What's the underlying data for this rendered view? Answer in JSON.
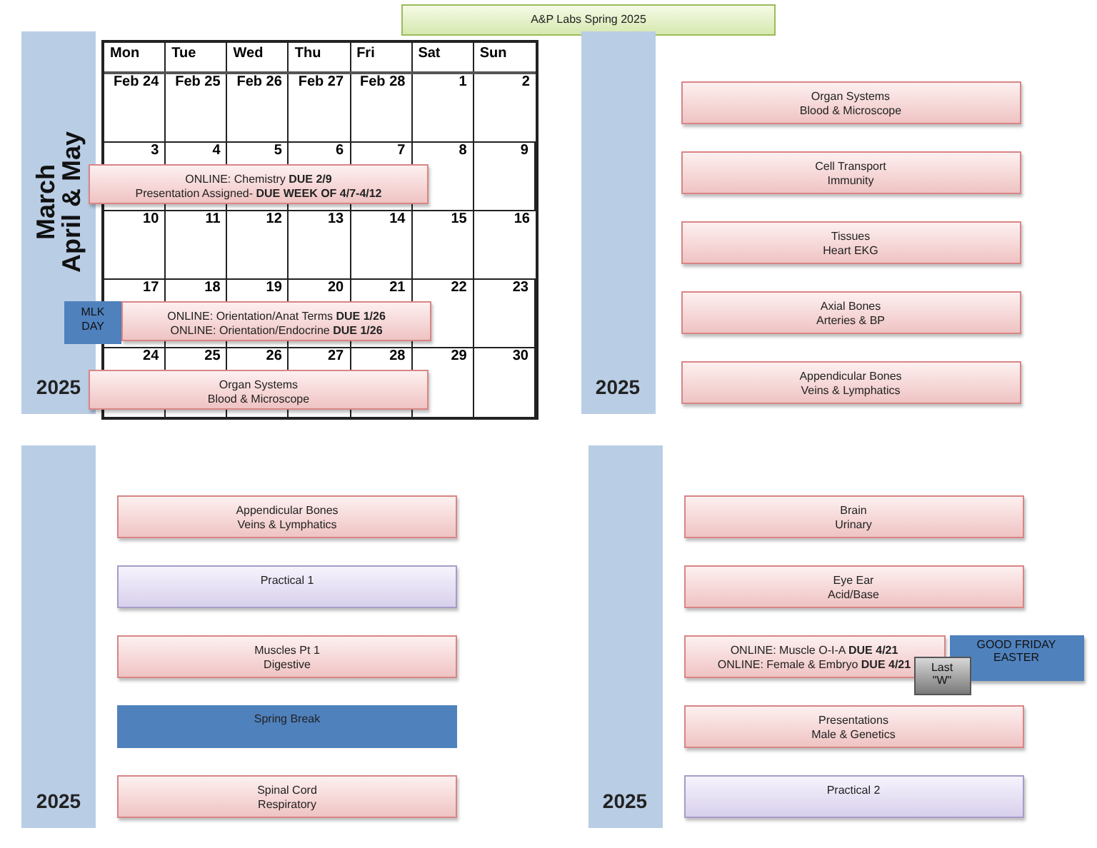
{
  "title": "A&P Labs Spring 2025",
  "calendar_panel": {
    "months": [
      "March",
      "April & May"
    ],
    "year": "2025",
    "days": [
      "Mon",
      "Tue",
      "Wed",
      "Thu",
      "Fri",
      "Sat",
      "Sun"
    ],
    "weeks": [
      {
        "dates": [
          "Feb 24",
          "Feb 25",
          "Feb 26",
          "Feb 27",
          "Feb 28",
          "1",
          "2"
        ]
      },
      {
        "dates": [
          "3",
          "4",
          "5",
          "6",
          "7",
          "8",
          "9"
        ],
        "event": {
          "kind": "topic",
          "lines": [
            "ONLINE:  Chemistry **DUE 2/9**",
            "Presentation Assigned- **DUE WEEK OF 4/7-4/12**"
          ]
        }
      },
      {
        "dates": [
          "10",
          "11",
          "12",
          "13",
          "14",
          "15",
          "16"
        ]
      },
      {
        "dates": [
          "17",
          "18",
          "19",
          "20",
          "21",
          "22",
          "23"
        ],
        "event": {
          "kind": "topic",
          "lines": [
            "ONLINE:  Orientation/Anat Terms **DUE 1/26**",
            "ONLINE:  Orientation/Endocrine **DUE 1/26**"
          ],
          "holiday": [
            "MLK",
            "DAY"
          ]
        }
      },
      {
        "dates": [
          "24",
          "25",
          "26",
          "27",
          "28",
          "29",
          "30"
        ],
        "event": {
          "kind": "topic",
          "lines": [
            "Organ Systems",
            "Blood & Microscope"
          ]
        }
      }
    ]
  },
  "panels": [
    {
      "year": "2025",
      "rows": [
        {
          "kind": "topic",
          "lines": [
            "Organ Systems",
            "Blood & Microscope"
          ]
        },
        {
          "kind": "topic",
          "lines": [
            "Cell Transport",
            "Immunity"
          ]
        },
        {
          "kind": "topic",
          "lines": [
            "Tissues",
            "Heart EKG"
          ]
        },
        {
          "kind": "topic",
          "lines": [
            "Axial Bones",
            "Arteries & BP"
          ]
        },
        {
          "kind": "topic",
          "lines": [
            "Appendicular Bones",
            "Veins & Lymphatics"
          ]
        }
      ]
    },
    {
      "year": "2025",
      "rows": [
        {
          "kind": "topic",
          "lines": [
            "Appendicular Bones",
            "Veins & Lymphatics"
          ]
        },
        {
          "kind": "practical",
          "lines": [
            "Practical 1"
          ]
        },
        {
          "kind": "topic",
          "lines": [
            "Muscles Pt 1",
            "Digestive"
          ]
        },
        {
          "kind": "break",
          "lines": [
            "Spring Break"
          ]
        },
        {
          "kind": "topic",
          "lines": [
            "Spinal Cord",
            "Respiratory"
          ]
        }
      ]
    },
    {
      "year": "2025",
      "rows": [
        {
          "kind": "topic",
          "lines": [
            "Brain",
            "Urinary"
          ]
        },
        {
          "kind": "topic",
          "lines": [
            "Eye Ear",
            "Acid/Base"
          ]
        },
        {
          "kind": "topic",
          "lines": [
            "ONLINE:  Muscle O-I-A **DUE 4/21**",
            "ONLINE: Female & Embryo **DUE 4/21**"
          ],
          "aside": [
            "GOOD FRIDAY",
            "EASTER"
          ],
          "note": [
            "Last",
            "\"W\""
          ]
        },
        {
          "kind": "topic",
          "lines": [
            "Presentations",
            "Male & Genetics"
          ]
        },
        {
          "kind": "practical",
          "lines": [
            "Practical 2"
          ]
        }
      ]
    }
  ]
}
